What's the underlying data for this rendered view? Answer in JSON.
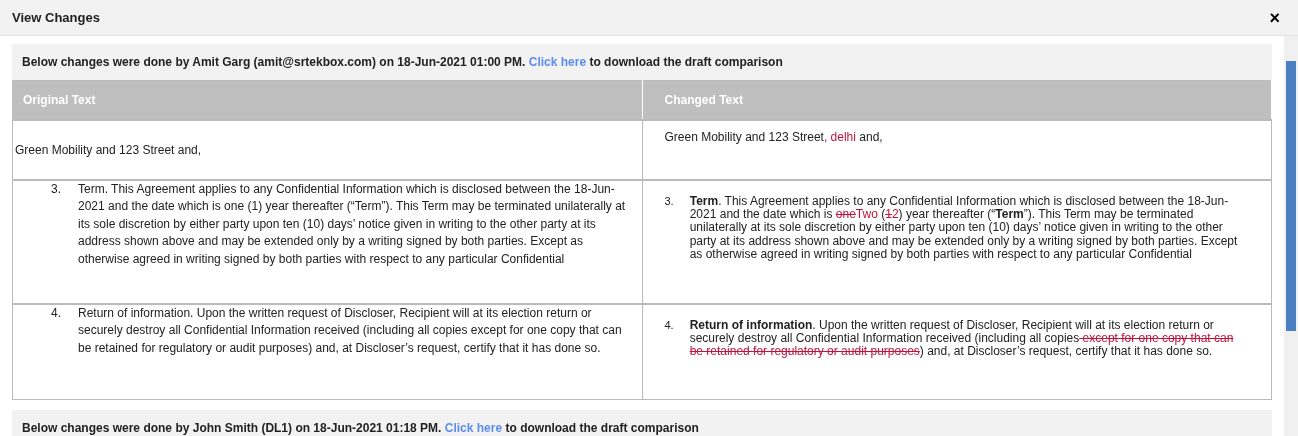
{
  "dialog": {
    "title": "View Changes",
    "close": "×"
  },
  "sections": [
    {
      "header": {
        "prefix": "Below changes were done by Amit Garg (amit@srtekbox.com) on 18-Jun-2021 01:00 PM.",
        "link": "Click here",
        "suffix": "to download the draft comparison"
      },
      "columns": [
        "Original Text",
        "Changed Text"
      ],
      "rows": [
        {
          "original": {
            "text": "Green Mobility and 123 Street and,"
          },
          "changed": {
            "segments": [
              {
                "kind": "plain",
                "text": "Green Mobility and 123 Street"
              },
              {
                "kind": "inserted",
                "text": ", delhi"
              },
              {
                "kind": "plain",
                "text": " and,"
              }
            ]
          }
        },
        {
          "original": {
            "number": "3.",
            "text": "Term.  This Agreement applies to any Confidential Information which is disclosed between the 18-Jun-2021 and the date which is one (1) year thereafter (“Term”). This Term may be terminated unilaterally at its sole discretion by either party upon ten (10) days’ notice given in writing to the other party at its address shown above and may be extended only by a writing signed by both parties. Except as otherwise agreed in writing signed by both parties with respect to any particular Confidential"
          },
          "changed": {
            "number": "3.",
            "segments": [
              {
                "kind": "bold",
                "text": "Term"
              },
              {
                "kind": "plain",
                "text": ".  This Agreement applies to any Confidential Information which is disclosed between the 18-Jun-2021 and the date which is "
              },
              {
                "kind": "deleted",
                "text": "one"
              },
              {
                "kind": "inserted",
                "text": "Two"
              },
              {
                "kind": "plain",
                "text": " ("
              },
              {
                "kind": "deleted",
                "text": "1"
              },
              {
                "kind": "inserted",
                "text": "2"
              },
              {
                "kind": "plain",
                "text": ") year thereafter (“"
              },
              {
                "kind": "bold",
                "text": "Term"
              },
              {
                "kind": "plain",
                "text": "”). This Term may be terminated unilaterally at its sole discretion by either party upon ten (10) days’ notice given in writing to the other party at its address shown above and may be extended only by a writing signed by both parties. Except as otherwise agreed in writing signed by both parties with respect to any particular Confidential"
              }
            ]
          }
        },
        {
          "original": {
            "number": "4.",
            "text": "Return of information.  Upon the written request of Discloser, Recipient will at its election return or securely destroy all Confidential Information received (including all copies except for one copy that can be retained for regulatory or audit purposes) and, at Discloser’s request, certify that it has done so."
          },
          "changed": {
            "number": "4.",
            "segments": [
              {
                "kind": "bold",
                "text": "Return of information"
              },
              {
                "kind": "plain",
                "text": ".  Upon the written request of Discloser, Recipient will at its election return or securely destroy all Confidential Information received (including all copies"
              },
              {
                "kind": "deleted",
                "text": " except for one copy that can be retained for regulatory or audit purposes"
              },
              {
                "kind": "plain",
                "text": ") and, at Discloser’s request, certify that it has done so."
              }
            ]
          }
        }
      ]
    },
    {
      "header": {
        "prefix": "Below changes were done by John Smith (DL1) on 18-Jun-2021 01:18 PM.",
        "link": "Click here",
        "suffix": "to download the draft comparison"
      }
    }
  ]
}
